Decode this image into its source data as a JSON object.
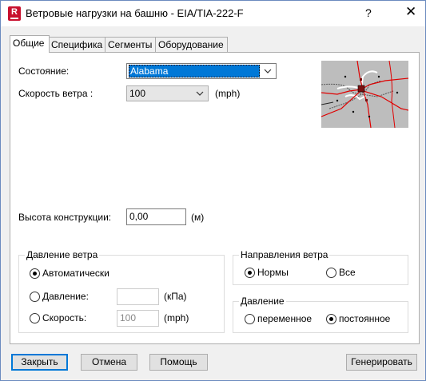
{
  "window": {
    "title": "Ветровые нагрузки на башню - EIA/TIA-222-F",
    "help_glyph": "?",
    "close_glyph": "✕",
    "app_icon_letter": "R"
  },
  "tabs": [
    {
      "label": "Общие",
      "active": true
    },
    {
      "label": "Специфика",
      "active": false
    },
    {
      "label": "Сегменты",
      "active": false
    },
    {
      "label": "Оборудование",
      "active": false
    }
  ],
  "general": {
    "state_label": "Состояние:",
    "state_value": "Alabama",
    "wind_speed_label": "Скорость ветра :",
    "wind_speed_value": "100",
    "wind_speed_unit": "(mph)",
    "height_label": "Высота конструкции:",
    "height_value": "0,00",
    "height_unit": "(м)"
  },
  "wind_pressure_group": {
    "legend": "Давление ветра",
    "auto_label": "Автоматически",
    "pressure_label": "Давление:",
    "pressure_value": "",
    "pressure_unit": "(кПа)",
    "speed_label": "Скорость:",
    "speed_value": "100",
    "speed_unit": "(mph)",
    "selected": "auto"
  },
  "wind_direction_group": {
    "legend": "Направления ветра",
    "norms_label": "Нормы",
    "all_label": "Все",
    "selected": "norms"
  },
  "pressure_group": {
    "legend": "Давление",
    "variable_label": "переменное",
    "constant_label": "постоянное",
    "selected": "constant"
  },
  "buttons": {
    "close": "Закрыть",
    "cancel": "Отмена",
    "help": "Помощь",
    "generate": "Генерировать"
  },
  "colors": {
    "accent": "#0078d7",
    "brand": "#c8102e",
    "map_road": "#e00000"
  }
}
